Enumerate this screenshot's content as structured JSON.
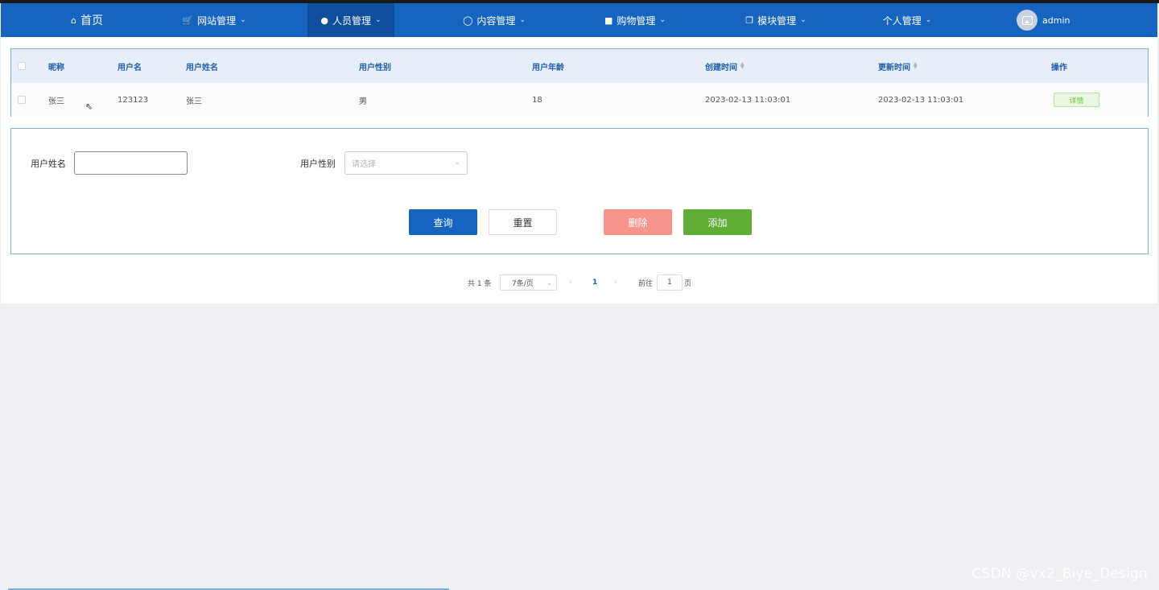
{
  "nav": {
    "items": [
      {
        "label": "首页",
        "icon": "home-icon"
      },
      {
        "label": "网站管理",
        "icon": "cart-icon"
      },
      {
        "label": "人员管理",
        "icon": "user-icon"
      },
      {
        "label": "内容管理",
        "icon": "chat-icon"
      },
      {
        "label": "购物管理",
        "icon": "bag-icon"
      },
      {
        "label": "模块管理",
        "icon": "copy-icon"
      },
      {
        "label": "个人管理",
        "icon": ""
      }
    ],
    "active": "人员管理",
    "user": "admin",
    "colors": {
      "bar": "#1464c0",
      "active": "#0d4f9c"
    }
  },
  "table": {
    "columns": [
      "昵称",
      "用户名",
      "用户姓名",
      "用户性别",
      "用户年龄",
      "创建时间",
      "更新时间",
      "操作"
    ],
    "rows": [
      {
        "nickname": "张三",
        "username": "123123",
        "realname": "张三",
        "gender": "男",
        "age": "18",
        "created": "2023-02-13 11:03:01",
        "updated": "2023-02-13 11:03:01",
        "action": "详情"
      }
    ]
  },
  "search": {
    "name_label": "用户姓名",
    "name_value": "",
    "gender_label": "用户性别",
    "gender_placeholder": "请选择",
    "buttons": {
      "query": "查询",
      "reset": "重置",
      "delete": "删除",
      "add": "添加"
    },
    "button_colors": {
      "query": "#1464c0",
      "delete": "#f7958c",
      "add": "#5faf37"
    }
  },
  "pagination": {
    "total_text": "共 1 条",
    "page_size": "7条/页",
    "current_page": "1",
    "jump_prefix": "前往",
    "jump_value": "1",
    "jump_suffix": "页"
  },
  "watermark": "CSDN @vx2_Biye_Design"
}
